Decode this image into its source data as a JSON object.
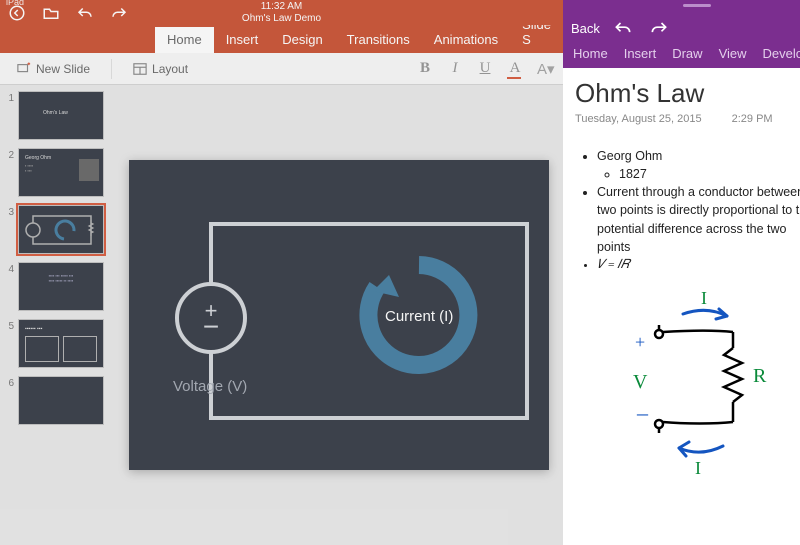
{
  "statusbar": {
    "device": "iPad",
    "time": "11:32 AM",
    "doc_title": "Ohm's Law Demo"
  },
  "pp_tabs": {
    "home": "Home",
    "insert": "Insert",
    "design": "Design",
    "transitions": "Transitions",
    "animations": "Animations",
    "slideshow": "Slide S"
  },
  "ribbon": {
    "new_slide": "New Slide",
    "layout": "Layout"
  },
  "fmt": {
    "bold": "B",
    "ital": "I",
    "und": "U",
    "strike": "A"
  },
  "slide_numbers": [
    "1",
    "2",
    "3",
    "4",
    "5",
    "6"
  ],
  "slide": {
    "current_label": "Current (I)",
    "voltage_label": "Voltage (V)",
    "plus": "+",
    "minus": "−"
  },
  "onenote": {
    "back": "Back",
    "tabs": {
      "home": "Home",
      "insert": "Insert",
      "draw": "Draw",
      "view": "View",
      "developer": "Developer"
    },
    "title": "Ohm's Law",
    "date": "Tuesday,  August 25, 2015",
    "time": "2:29 PM",
    "bul1": "Georg Ohm",
    "bul1a": "1827",
    "bul2": "Current through a conductor between two points is directly proportional to the potential difference across the two points",
    "bul3": "𝑉 = 𝐼𝑅",
    "ink": {
      "I_top": "I",
      "I_bot": "I",
      "V": "V",
      "R": "R",
      "plus": "+",
      "minus": "–"
    }
  },
  "thumbs": {
    "t1_title": "Ohm's Law",
    "t2_title": "Georg Ohm"
  }
}
